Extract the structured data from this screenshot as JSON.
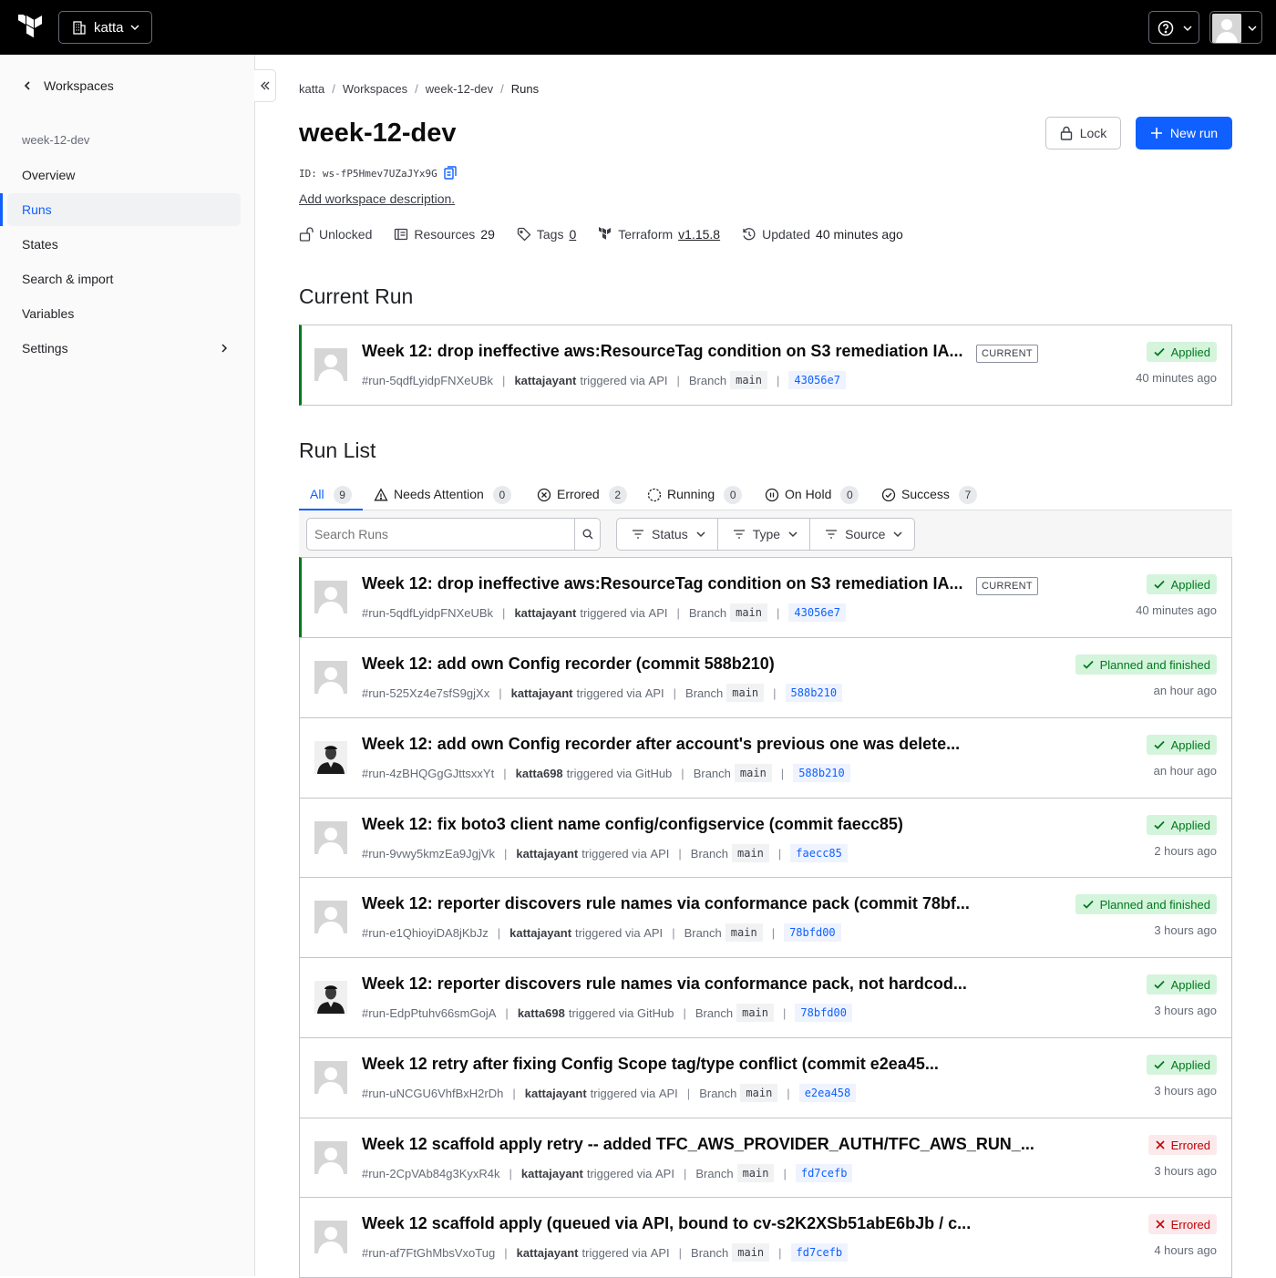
{
  "topbar": {
    "org": "katta"
  },
  "sidebar": {
    "back_label": "Workspaces",
    "workspace": "week-12-dev",
    "items": [
      {
        "label": "Overview"
      },
      {
        "label": "Runs"
      },
      {
        "label": "States"
      },
      {
        "label": "Search & import"
      },
      {
        "label": "Variables"
      },
      {
        "label": "Settings"
      }
    ]
  },
  "breadcrumb": [
    "katta",
    "Workspaces",
    "week-12-dev",
    "Runs"
  ],
  "header": {
    "title": "week-12-dev",
    "id_label": "ID:",
    "id": "ws-fP5Hmev7UZaJYx9G",
    "add_description": "Add workspace description.",
    "lock_label": "Lock",
    "new_run_label": "New run"
  },
  "meta": {
    "lock_status": "Unlocked",
    "resources_label": "Resources",
    "resources_count": "29",
    "tags_label": "Tags",
    "tags_count": "0",
    "terraform_label": "Terraform",
    "terraform_version": "v1.15.8",
    "updated_label": "Updated",
    "updated_value": "40 minutes ago"
  },
  "current_run_heading": "Current Run",
  "run_list_heading": "Run List",
  "current_badge": "CURRENT",
  "labels": {
    "triggered_via": "triggered via",
    "branch": "Branch"
  },
  "current_run": {
    "title": "Week 12: drop ineffective aws:ResourceTag condition on S3 remediation IA...",
    "id": "#run-5qdfLyidpFNXeUBk",
    "user": "kattajayant",
    "source": "API",
    "branch": "main",
    "commit": "43056e7",
    "status": "Applied",
    "time": "40 minutes ago"
  },
  "tabs": [
    {
      "label": "All",
      "count": "9"
    },
    {
      "label": "Needs Attention",
      "count": "0"
    },
    {
      "label": "Errored",
      "count": "2"
    },
    {
      "label": "Running",
      "count": "0"
    },
    {
      "label": "On Hold",
      "count": "0"
    },
    {
      "label": "Success",
      "count": "7"
    }
  ],
  "search": {
    "placeholder": "Search Runs"
  },
  "filters": [
    "Status",
    "Type",
    "Source"
  ],
  "runs": [
    {
      "title": "Week 12: drop ineffective aws:ResourceTag condition on S3 remediation IA...",
      "id": "#run-5qdfLyidpFNXeUBk",
      "user": "kattajayant",
      "source": "API",
      "branch": "main",
      "commit": "43056e7",
      "status": "Applied",
      "time": "40 minutes ago"
    },
    {
      "title": "Week 12: add own Config recorder (commit 588b210)",
      "id": "#run-525Xz4e7sfS9gjXx",
      "user": "kattajayant",
      "source": "API",
      "branch": "main",
      "commit": "588b210",
      "status": "Planned and finished",
      "time": "an hour ago"
    },
    {
      "title": "Week 12: add own Config recorder after account's previous one was delete...",
      "id": "#run-4zBHQGgGJttsxxYt",
      "user": "katta698",
      "source": "GitHub",
      "branch": "main",
      "commit": "588b210",
      "status": "Applied",
      "time": "an hour ago"
    },
    {
      "title": "Week 12: fix boto3 client name config/configservice (commit faecc85)",
      "id": "#run-9vwy5kmzEa9JgjVk",
      "user": "kattajayant",
      "source": "API",
      "branch": "main",
      "commit": "faecc85",
      "status": "Applied",
      "time": "2 hours ago"
    },
    {
      "title": "Week 12: reporter discovers rule names via conformance pack (commit 78bf...",
      "id": "#run-e1QhioyiDA8jKbJz",
      "user": "kattajayant",
      "source": "API",
      "branch": "main",
      "commit": "78bfd00",
      "status": "Planned and finished",
      "time": "3 hours ago"
    },
    {
      "title": "Week 12: reporter discovers rule names via conformance pack, not hardcod...",
      "id": "#run-EdpPtuhv66smGojA",
      "user": "katta698",
      "source": "GitHub",
      "branch": "main",
      "commit": "78bfd00",
      "status": "Applied",
      "time": "3 hours ago"
    },
    {
      "title": "Week 12 retry after fixing Config Scope tag/type conflict (commit e2ea45...",
      "id": "#run-uNCGU6VhfBxH2rDh",
      "user": "kattajayant",
      "source": "API",
      "branch": "main",
      "commit": "e2ea458",
      "status": "Applied",
      "time": "3 hours ago"
    },
    {
      "title": "Week 12 scaffold apply retry -- added TFC_AWS_PROVIDER_AUTH/TFC_AWS_RUN_...",
      "id": "#run-2CpVAb84g3KyxR4k",
      "user": "kattajayant",
      "source": "API",
      "branch": "main",
      "commit": "fd7cefb",
      "status": "Errored",
      "time": "3 hours ago"
    },
    {
      "title": "Week 12 scaffold apply (queued via API, bound to cv-s2K2XSb51abE6bJb / c...",
      "id": "#run-af7FtGhMbsVxoTug",
      "user": "kattajayant",
      "source": "API",
      "branch": "main",
      "commit": "fd7cefb",
      "status": "Errored",
      "time": "4 hours ago"
    }
  ]
}
